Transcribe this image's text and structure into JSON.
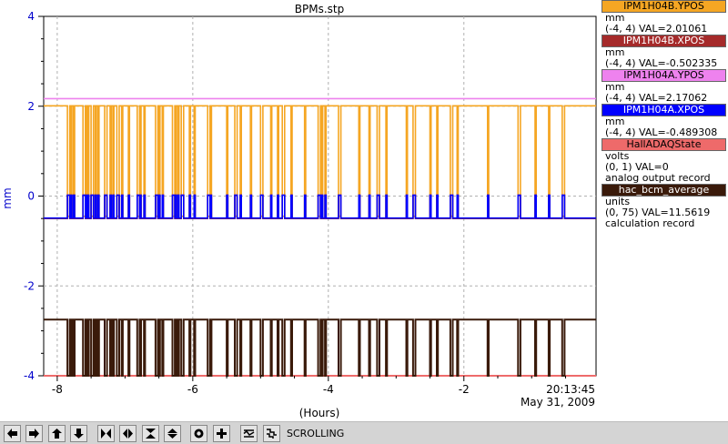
{
  "chart_data": {
    "type": "line",
    "title": "BPMs.stp",
    "ylabel": "mm",
    "xlabel": "(Hours)",
    "xlim": [
      -8.2,
      -0.05
    ],
    "ylim": [
      -4,
      4
    ],
    "x_ticks": [
      -8,
      -6,
      -4,
      -2
    ],
    "x_tick_labels": [
      "-8",
      "-6",
      "-4",
      "-2"
    ],
    "y_ticks": [
      -4,
      -2,
      0,
      2,
      4
    ],
    "y_tick_labels": [
      "-4",
      "-2",
      "0",
      "2",
      "4"
    ],
    "time_label": "20:13:45",
    "date_label": "May 31, 2009",
    "grid": true,
    "legend_position": "right",
    "series": [
      {
        "name": "IPM1H04B.YPOS",
        "color": "#f5a623",
        "units": "mm",
        "range": "(-4, 4)",
        "val": "VAL=2.01061",
        "baseline": 2.01,
        "drop_to": -0.45
      },
      {
        "name": "IPM1H04B.XPOS",
        "color": "#a52a2a",
        "units": "mm",
        "range": "(-4, 4)",
        "val": "VAL=-0.502335",
        "baseline": -0.5,
        "drop_to": 0.02
      },
      {
        "name": "IPM1H04A.YPOS",
        "color": "#ee82ee",
        "units": "mm",
        "range": "(-4, 4)",
        "val": "VAL=2.17062",
        "baseline": 2.17,
        "drop_to": 2.17
      },
      {
        "name": "IPM1H04A.XPOS",
        "color": "#0000ff",
        "units": "mm",
        "range": "(-4, 4)",
        "val": "VAL=-0.489308",
        "baseline": -0.49,
        "drop_to": 0.02
      },
      {
        "name": "HallADAQState",
        "color": "#ee6a6a",
        "units": "volts",
        "range": "(0, 1)",
        "val": "VAL=0",
        "note": "analog output record",
        "baseline": -4.0,
        "drop_to": -4.0
      },
      {
        "name": "hac_bcm_average",
        "color": "#3a1a0a",
        "units": "units",
        "range": "(0, 75)",
        "val": "VAL=11.5619",
        "note": "calculation record",
        "baseline": -2.75,
        "drop_to": -4.0
      }
    ],
    "beam_trips_hours": [
      -7.85,
      -7.8,
      -7.76,
      -7.62,
      -7.58,
      -7.55,
      -7.5,
      -7.44,
      -7.4,
      -7.3,
      -7.22,
      -7.18,
      -7.12,
      -7.05,
      -6.95,
      -6.82,
      -6.78,
      -6.72,
      -6.55,
      -6.5,
      -6.45,
      -6.3,
      -6.26,
      -6.22,
      -6.17,
      -6.05,
      -5.98,
      -5.78,
      -5.74,
      -5.5,
      -5.38,
      -5.3,
      -5.15,
      -5.0,
      -4.85,
      -4.75,
      -4.68,
      -4.55,
      -4.35,
      -4.15,
      -4.1,
      -4.05,
      -3.85,
      -3.55,
      -3.4,
      -3.28,
      -3.15,
      -2.85,
      -2.75,
      -2.5,
      -2.4,
      -2.2,
      -2.1,
      -1.65,
      -1.2,
      -0.95,
      -0.75,
      -0.55
    ]
  },
  "toolbar": {
    "icons": [
      "arrow-left",
      "arrow-right",
      "arrow-up",
      "arrow-down",
      "shrink-h",
      "expand-h",
      "shrink-v",
      "expand-v",
      "record",
      "plus",
      "home",
      "stagger"
    ],
    "status_label": "SCROLLING"
  }
}
